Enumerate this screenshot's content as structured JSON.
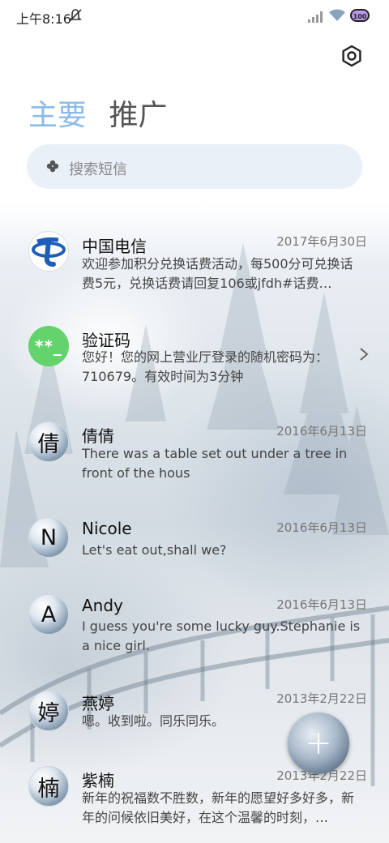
{
  "status_bar": {
    "time": "上午8:16",
    "battery": "100",
    "icons": [
      "mute-icon",
      "signal-icon",
      "wifi-icon",
      "battery-icon"
    ]
  },
  "header": {
    "tabs": [
      {
        "label": "主要",
        "active": true
      },
      {
        "label": "推广",
        "active": false
      }
    ],
    "settings_icon": "gear-icon"
  },
  "search": {
    "placeholder": "搜索短信",
    "icon": "clover-icon"
  },
  "conversations": [
    {
      "name": "中国电信",
      "date": "2017年6月30日",
      "preview": "欢迎参加积分兑换话费活动，每500分可兑换话费5元，兑换话费请回复106或jfdh#话费…",
      "avatar": "telecom-logo"
    },
    {
      "name": "验证码",
      "date": "",
      "preview": "您好！您的网上营业厅登录的随机密码为：710679。有效时间为3分钟",
      "avatar_text": "**_"
    },
    {
      "name": "倩倩",
      "date": "2016年6月13日",
      "preview": "There was a table set out under a tree in front of the hous",
      "avatar_text": "倩"
    },
    {
      "name": "Nicole",
      "date": "2016年6月13日",
      "preview": "Let's eat out,shall we?",
      "avatar_text": "N"
    },
    {
      "name": "Andy",
      "date": "2016年6月13日",
      "preview": "I guess you're some lucky guy.Stephanie is a nice girl.",
      "avatar_text": "A"
    },
    {
      "name": "燕婷",
      "date": "2013年2月22日",
      "preview": "嗯。收到啦。同乐同乐。",
      "avatar_text": "婷"
    },
    {
      "name": "紫楠",
      "date": "2013年2月22日",
      "preview": "新年的祝福数不胜数，新年的愿望好多好多，新年的问候依旧美好，在这个温馨的时刻，…",
      "avatar_text": "楠"
    }
  ],
  "fab": {
    "label": "+",
    "icon": "plus-icon"
  }
}
